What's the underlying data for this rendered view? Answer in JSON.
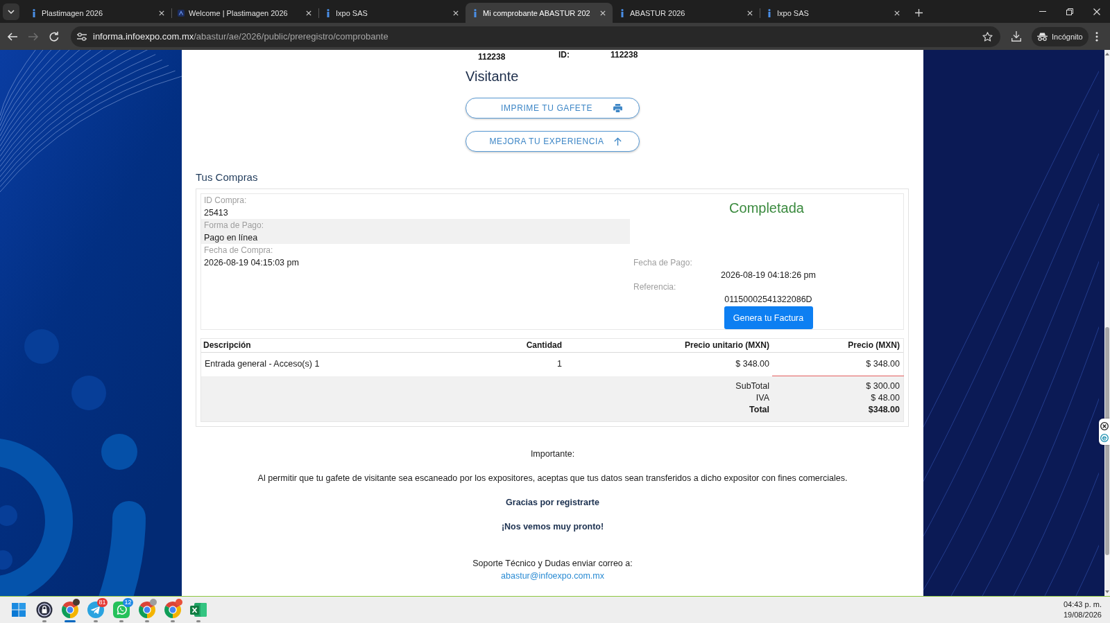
{
  "browser": {
    "tabs": [
      {
        "title": "Plastimagen 2026",
        "kind": "info",
        "selected": false
      },
      {
        "title": "Welcome | Plastimagen 2026",
        "kind": "logo",
        "selected": false
      },
      {
        "title": "Ixpo SAS",
        "kind": "info",
        "selected": false
      },
      {
        "title": "Mi comprobante ABASTUR 202",
        "kind": "info",
        "selected": true
      },
      {
        "title": "ABASTUR 2026",
        "kind": "info",
        "selected": false
      },
      {
        "title": "Ixpo SAS",
        "kind": "info",
        "selected": false
      }
    ],
    "nav": [
      {
        "kind": "back",
        "disabled": false
      },
      {
        "kind": "forward",
        "disabled": true
      },
      {
        "kind": "reload",
        "disabled": false
      }
    ],
    "address": {
      "host": "informa.infoexpo.com.mx",
      "path": "/abastur/ae/2026/public/preregistro/comprobante"
    },
    "profile_label": "Incógnito"
  },
  "page": {
    "partial_row": {
      "label": "ID:",
      "value": "112238"
    },
    "registration_number": "112238",
    "attendee_type": "Visitante",
    "actions": [
      {
        "label": "IMPRIME TU GAFETE",
        "kind": "print"
      },
      {
        "label": "MEJORA TU EXPERIENCIA",
        "kind": "upgrade"
      }
    ],
    "purchases": {
      "title": "Tus Compras",
      "fields": [
        {
          "label": "ID Compra:",
          "value": "25413",
          "highlighted": false
        },
        {
          "label": "Forma de Pago:",
          "value": "Pago en línea",
          "highlighted": true
        },
        {
          "label": "Fecha de Compra:",
          "value": "2026-08-19 04:15:03 pm",
          "highlighted": false
        }
      ],
      "status": "Completada",
      "payment_fields": [
        {
          "label": "Fecha de Pago:",
          "value": "2026-08-19 04:18:26 pm"
        },
        {
          "label": "Referencia:",
          "value": "01150002541322086D"
        }
      ],
      "invoice_button": "Genera tu Factura",
      "table": {
        "columns": [
          "Descripción",
          "Cantidad",
          "Precio unitario (MXN)",
          "Precio (MXN)"
        ],
        "rows": [
          [
            "Entrada general - Acceso(s) 1",
            "1",
            "$ 348.00",
            "$ 348.00"
          ]
        ],
        "totals": [
          {
            "label": "SubTotal",
            "value": "$ 300.00",
            "kind": "line"
          },
          {
            "label": "IVA",
            "value": "$ 48.00",
            "kind": "line"
          },
          {
            "label": "Total",
            "value": "$348.00",
            "kind": "total"
          }
        ]
      }
    },
    "notice": {
      "heading": "Importante:",
      "text": "Al permitir que tu gafete de visitante sea escaneado por los expositores, aceptas que tus datos sean transferidos a dicho expositor con fines comerciales.",
      "thanks": "Gracias por registrarte",
      "farewell": "¡Nos vemos muy pronto!",
      "support": "Soporte Técnico y Dudas enviar correo a:",
      "email": "abastur@infoexpo.com.mx"
    }
  },
  "taskbar": {
    "apps": [
      {
        "kind": "lock",
        "active": false
      },
      {
        "kind": "chrome",
        "color": "#4a3a30",
        "active": true
      },
      {
        "kind": "telegram",
        "badge": "81",
        "active": false
      },
      {
        "kind": "whatsapp",
        "badge": "12",
        "active": false
      },
      {
        "kind": "chrome",
        "color": "#9e9e9e",
        "active": false
      },
      {
        "kind": "chrome",
        "color": "#e8503a",
        "active": false
      },
      {
        "kind": "excel",
        "active": false
      }
    ],
    "time": "04:43 p. m.",
    "date": "19/08/2026"
  }
}
